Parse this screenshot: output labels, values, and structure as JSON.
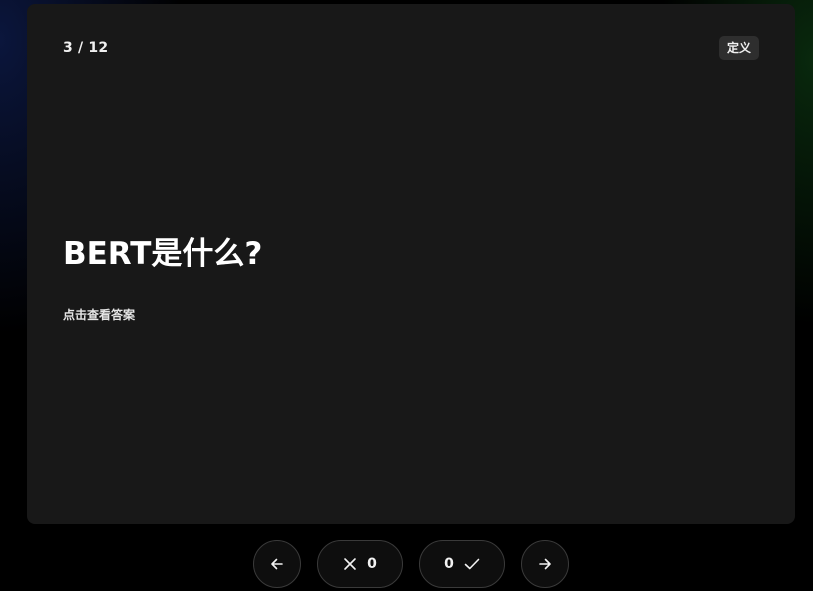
{
  "card": {
    "counter": "3 / 12",
    "tag": "定义",
    "question": "BERT是什么?",
    "hint": "点击查看答案"
  },
  "controls": {
    "wrong_count": "0",
    "right_count": "0"
  },
  "icons": {
    "prev": "arrow-left-icon",
    "wrong": "x-icon",
    "right": "check-icon",
    "next": "arrow-right-icon"
  }
}
